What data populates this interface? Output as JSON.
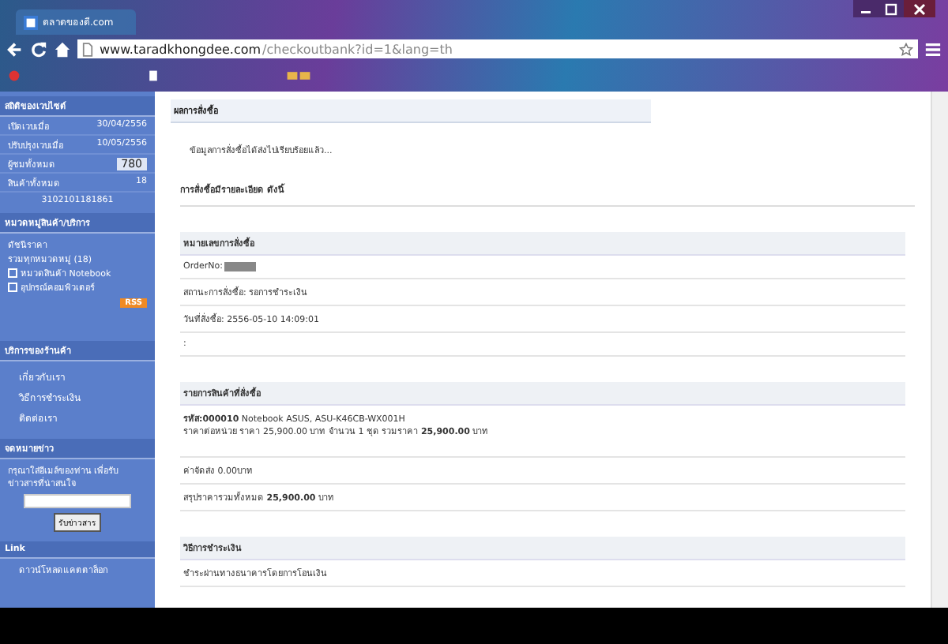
{
  "browser": {
    "tab_title": "ตลาดของดี.com",
    "url_domain": "www.taradkhongdee.com",
    "url_path": "/checkoutbank?id=1&lang=th"
  },
  "sidebar": {
    "stats": {
      "title": "สถิติของเวบไซต์",
      "rows": [
        {
          "label": "เปิดเวบเมื่อ",
          "value": "30/04/2556",
          "highlight": false
        },
        {
          "label": "ปรับปรุงเวบเมื่อ",
          "value": "10/05/2556",
          "highlight": false
        },
        {
          "label": "ผู้ชมทั้งหมด",
          "value": "780",
          "highlight": true
        },
        {
          "label": "สินค้าทั้งหมด",
          "value": "18",
          "highlight": false
        }
      ],
      "code": "3102101181861"
    },
    "categories": {
      "title": "หมวดหมู่สินค้า/บริการ",
      "items": [
        {
          "label": "ดัชนีราคา",
          "kind": "plain"
        },
        {
          "label": "รวมทุกหมวดหมู่ (18)",
          "kind": "plain"
        },
        {
          "label": "หมวดสินค้า Notebook",
          "kind": "expandable"
        },
        {
          "label": "อุปกรณ์คอมพิวเตอร์",
          "kind": "expandable"
        }
      ],
      "rss": "RSS"
    },
    "services": {
      "title": "บริการของร้านค้า",
      "links": [
        "เกี่ยวกับเรา",
        "วิธีการชำระเงิน",
        "ติดต่อเรา"
      ]
    },
    "newsletter": {
      "title": "จดหมายข่าว",
      "text": "กรุณาใส่อีเมล์ของท่าน เพื่อรับข่าวสารที่น่าสนใจ",
      "button": "รับข่าวสาร"
    },
    "links": {
      "title": "Link",
      "items": [
        "ดาวน์โหลดแคตตาล็อก"
      ]
    }
  },
  "content": {
    "tab": "ผลการสั่งซื้อ",
    "message": "ข้อมูลการสั่งซื้อได้ส่งไปเรียบร้อยแล้ว...",
    "heading": "การสั่งซื้อมีรายละเอียด ดังนี้",
    "sections": [
      {
        "title": "หมายเลขการสั่งซื้อ",
        "rows": [
          {
            "text": "OrderNo:",
            "redacted": true
          },
          {
            "text": "สถานะการสั่งซื้อ: รอการชำระเงิน",
            "redacted": false
          },
          {
            "text": "วันที่สั่งซื้อ: 2556-05-10 14:09:01",
            "redacted": false
          },
          {
            "text": ":",
            "redacted": false
          }
        ]
      },
      {
        "title": "รายการสินค้าที่สั่งซื้อ",
        "rows": [
          {
            "text": "**รหัส:000010** Notebook ASUS, ASU-K46CB-WX001H",
            "redacted": false,
            "sub": "ราคาต่อหน่วย ราคา 25,900.00 บาท จำนวน 1 ชุด รวมราคา **25,900.00** บาท"
          },
          {
            "text": "ค่าจัดส่ง 0.00บาท",
            "redacted": false
          },
          {
            "text": "สรุปราคารวมทั้งหมด **25,900.00** บาท",
            "redacted": false
          }
        ]
      },
      {
        "title": "วิธีการชำระเงิน",
        "rows": [
          {
            "text": "ชำระผ่านทางธนาคารโดยการโอนเงิน",
            "redacted": false
          }
        ]
      }
    ]
  }
}
